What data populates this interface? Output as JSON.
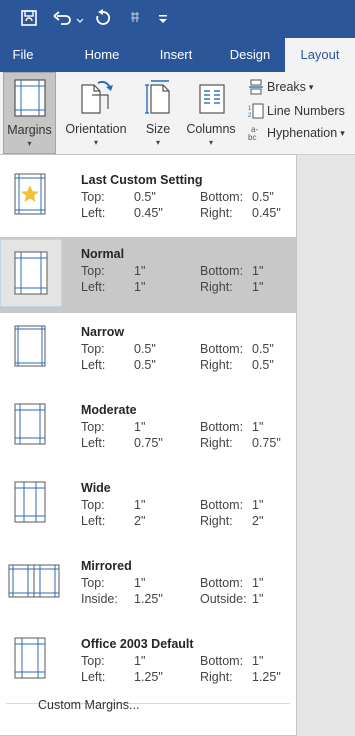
{
  "quick_access": {
    "items": [
      {
        "icon": "save-icon"
      },
      {
        "icon": "undo-icon"
      },
      {
        "icon": "redo-icon"
      },
      {
        "icon": "touch-mode-icon"
      },
      {
        "icon": "customize-qat-icon"
      }
    ]
  },
  "tabs": [
    {
      "label": "File",
      "active": false
    },
    {
      "label": "Home",
      "active": false
    },
    {
      "label": "Insert",
      "active": false
    },
    {
      "label": "Design",
      "active": false
    },
    {
      "label": "Layout",
      "active": true
    }
  ],
  "ribbon": {
    "margins_label": "Margins",
    "orientation_label": "Orientation",
    "size_label": "Size",
    "columns_label": "Columns",
    "dropdown_glyph": "▾",
    "breaks_label": "Breaks",
    "breaks_caret": "▾",
    "line_numbers_label": "Line Numbers",
    "hyphenation_label": "Hyphenation",
    "hyphenation_caret": "▾"
  },
  "margin_options": [
    {
      "name": "Last Custom Setting",
      "top_label": "Top:",
      "top": "0.5\"",
      "bottom_label": "Bottom:",
      "bottom": "0.5\"",
      "left_label": "Left:",
      "left": "0.45\"",
      "right_label": "Right:",
      "right": "0.45\"",
      "selected": false
    },
    {
      "name": "Normal",
      "top_label": "Top:",
      "top": "1\"",
      "bottom_label": "Bottom:",
      "bottom": "1\"",
      "left_label": "Left:",
      "left": "1\"",
      "right_label": "Right:",
      "right": "1\"",
      "selected": true
    },
    {
      "name": "Narrow",
      "top_label": "Top:",
      "top": "0.5\"",
      "bottom_label": "Bottom:",
      "bottom": "0.5\"",
      "left_label": "Left:",
      "left": "0.5\"",
      "right_label": "Right:",
      "right": "0.5\"",
      "selected": false
    },
    {
      "name": "Moderate",
      "top_label": "Top:",
      "top": "1\"",
      "bottom_label": "Bottom:",
      "bottom": "1\"",
      "left_label": "Left:",
      "left": "0.75\"",
      "right_label": "Right:",
      "right": "0.75\"",
      "selected": false
    },
    {
      "name": "Wide",
      "top_label": "Top:",
      "top": "1\"",
      "bottom_label": "Bottom:",
      "bottom": "1\"",
      "left_label": "Left:",
      "left": "2\"",
      "right_label": "Right:",
      "right": "2\"",
      "selected": false
    },
    {
      "name": "Mirrored",
      "top_label": "Top:",
      "top": "1\"",
      "bottom_label": "Bottom:",
      "bottom": "1\"",
      "left_label": "Inside:",
      "left": "1.25\"",
      "right_label": "Outside:",
      "right": "1\"",
      "selected": false
    },
    {
      "name": "Office 2003 Default",
      "top_label": "Top:",
      "top": "1\"",
      "bottom_label": "Bottom:",
      "bottom": "1\"",
      "left_label": "Left:",
      "left": "1.25\"",
      "right_label": "Right:",
      "right": "1.25\"",
      "selected": false
    }
  ],
  "custom_margins_label": "Custom Margins...",
  "colors": {
    "brand": "#2b579a",
    "ribbon_bg": "#f3f3f3",
    "selected_bg": "#c8c8c8",
    "icon_blue": "#2b6cb8",
    "star": "#f0c23a"
  }
}
